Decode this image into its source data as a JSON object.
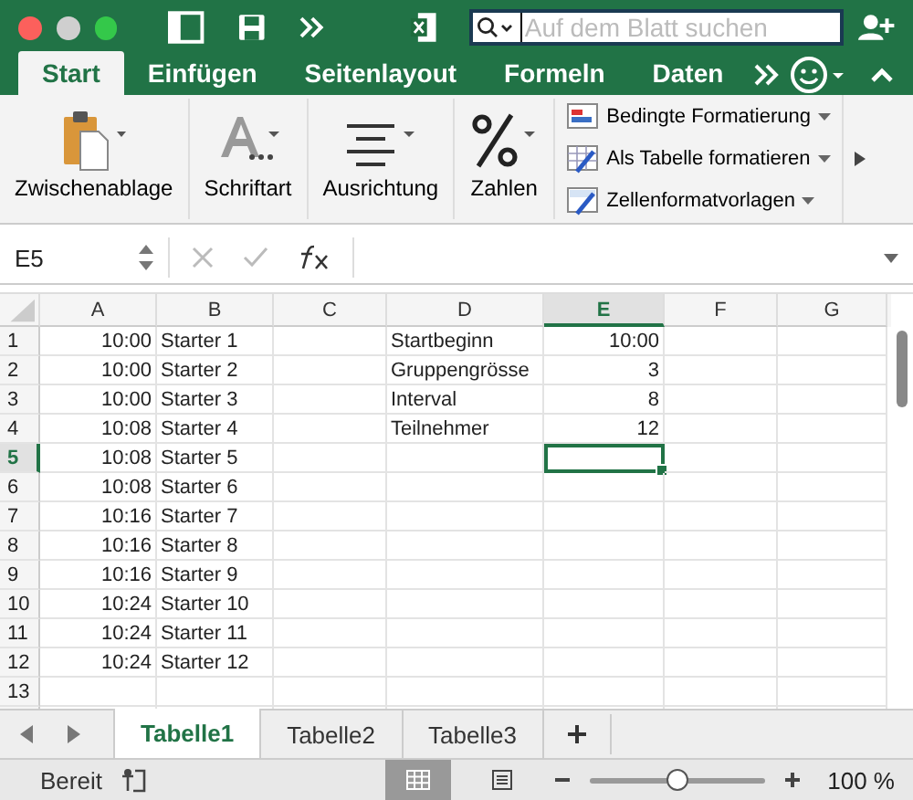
{
  "title_bar": {
    "search": {
      "placeholder": "Auf dem Blatt suchen"
    }
  },
  "ribbon_tabs": [
    {
      "label": "Start",
      "selected": true
    },
    {
      "label": "Einfügen",
      "selected": false
    },
    {
      "label": "Seitenlayout",
      "selected": false
    },
    {
      "label": "Formeln",
      "selected": false
    },
    {
      "label": "Daten",
      "selected": false
    }
  ],
  "ribbon_groups": [
    {
      "label": "Zwischenablage",
      "kind": "clipboard"
    },
    {
      "label": "Schriftart",
      "kind": "font"
    },
    {
      "label": "Ausrichtung",
      "kind": "align"
    },
    {
      "label": "Zahlen",
      "kind": "percent"
    }
  ],
  "style_commands": [
    {
      "label": "Bedingte Formatierung",
      "kind": "conditional"
    },
    {
      "label": "Als Tabelle formatieren",
      "kind": "table"
    },
    {
      "label": "Zellenformatvorlagen",
      "kind": "cellstyle"
    }
  ],
  "formula_bar": {
    "name_box": "E5"
  },
  "columns": [
    {
      "label": "A",
      "kind": "number",
      "selected": false
    },
    {
      "label": "B",
      "kind": "text",
      "selected": false
    },
    {
      "label": "C",
      "kind": "text",
      "selected": false
    },
    {
      "label": "D",
      "kind": "text",
      "selected": false
    },
    {
      "label": "E",
      "kind": "number",
      "selected": true
    },
    {
      "label": "F",
      "kind": "text",
      "selected": false
    },
    {
      "label": "G",
      "kind": "text",
      "selected": false
    }
  ],
  "rows": [
    {
      "label": "1",
      "selected": false,
      "cells": [
        "10:00",
        "Starter 1",
        "",
        "Startbeginn",
        "10:00",
        "",
        ""
      ]
    },
    {
      "label": "2",
      "selected": false,
      "cells": [
        "10:00",
        "Starter 2",
        "",
        "Gruppengrösse",
        "3",
        "",
        ""
      ]
    },
    {
      "label": "3",
      "selected": false,
      "cells": [
        "10:00",
        "Starter 3",
        "",
        "Interval",
        "8",
        "",
        ""
      ]
    },
    {
      "label": "4",
      "selected": false,
      "cells": [
        "10:08",
        "Starter 4",
        "",
        "Teilnehmer",
        "12",
        "",
        ""
      ]
    },
    {
      "label": "5",
      "selected": true,
      "cells": [
        "10:08",
        "Starter 5",
        "",
        "",
        "",
        "",
        ""
      ]
    },
    {
      "label": "6",
      "selected": false,
      "cells": [
        "10:08",
        "Starter 6",
        "",
        "",
        "",
        "",
        ""
      ]
    },
    {
      "label": "7",
      "selected": false,
      "cells": [
        "10:16",
        "Starter 7",
        "",
        "",
        "",
        "",
        ""
      ]
    },
    {
      "label": "8",
      "selected": false,
      "cells": [
        "10:16",
        "Starter 8",
        "",
        "",
        "",
        "",
        ""
      ]
    },
    {
      "label": "9",
      "selected": false,
      "cells": [
        "10:16",
        "Starter 9",
        "",
        "",
        "",
        "",
        ""
      ]
    },
    {
      "label": "10",
      "selected": false,
      "cells": [
        "10:24",
        "Starter 10",
        "",
        "",
        "",
        "",
        ""
      ]
    },
    {
      "label": "11",
      "selected": false,
      "cells": [
        "10:24",
        "Starter 11",
        "",
        "",
        "",
        "",
        ""
      ]
    },
    {
      "label": "12",
      "selected": false,
      "cells": [
        "10:24",
        "Starter 12",
        "",
        "",
        "",
        "",
        ""
      ]
    },
    {
      "label": "13",
      "selected": false,
      "cells": [
        "",
        "",
        "",
        "",
        "",
        "",
        ""
      ]
    }
  ],
  "sheet_tabs": [
    {
      "label": "Tabelle1",
      "selected": true
    },
    {
      "label": "Tabelle2",
      "selected": false
    },
    {
      "label": "Tabelle3",
      "selected": false
    }
  ],
  "status_bar": {
    "status": "Bereit",
    "zoom": {
      "level": 0.5,
      "reading": "100 %"
    }
  }
}
